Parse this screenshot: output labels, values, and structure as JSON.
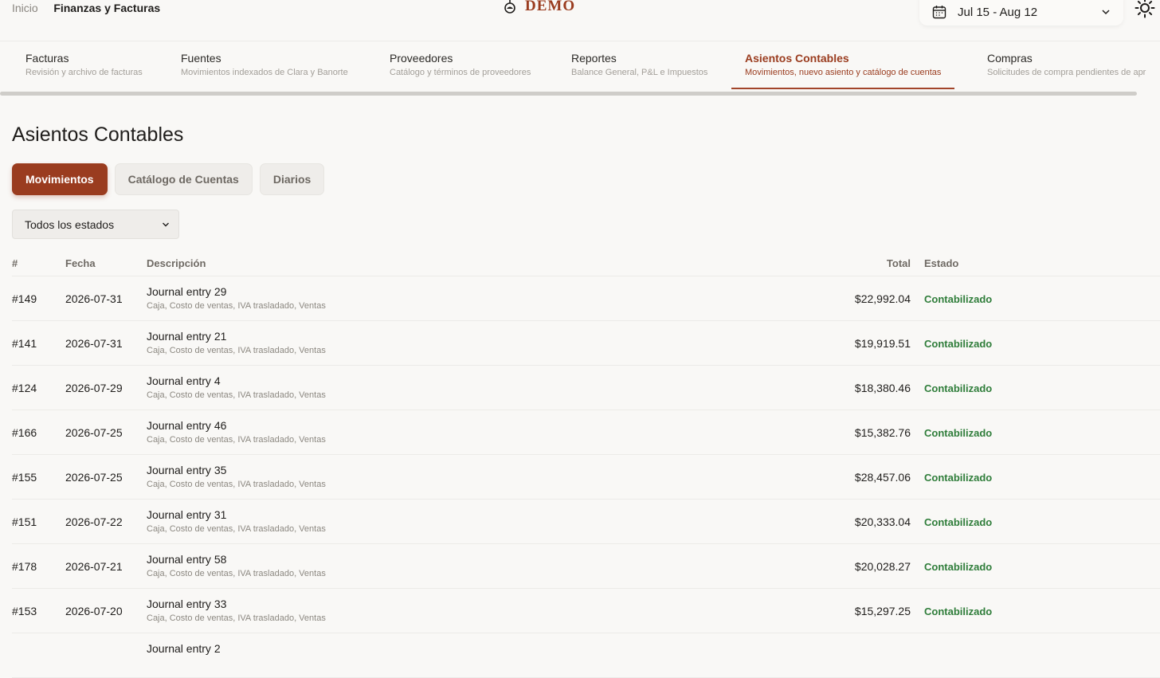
{
  "header": {
    "breadcrumb_home": "Inicio",
    "breadcrumb_separator": "/",
    "breadcrumb_current": "Finanzas y Facturas",
    "logo_text": "DEMO",
    "date_range": "Jul 15 - Aug 12"
  },
  "tabs": [
    {
      "title": "Facturas",
      "subtitle": "Revisión y archivo de facturas"
    },
    {
      "title": "Fuentes",
      "subtitle": "Movimientos indexados de Clara y Banorte"
    },
    {
      "title": "Proveedores",
      "subtitle": "Catálogo y términos de proveedores"
    },
    {
      "title": "Reportes",
      "subtitle": "Balance General, P&L e Impuestos"
    },
    {
      "title": "Asientos Contables",
      "subtitle": "Movimientos, nuevo asiento y catálogo de cuentas"
    },
    {
      "title": "Compras",
      "subtitle": "Solicitudes de compra pendientes de apr"
    }
  ],
  "page": {
    "title": "Asientos Contables",
    "segments": [
      "Movimientos",
      "Catálogo de Cuentas",
      "Diarios"
    ],
    "filter_value": "Todos los estados"
  },
  "table": {
    "headers": {
      "num": "#",
      "date": "Fecha",
      "desc": "Descripción",
      "total": "Total",
      "status": "Estado"
    },
    "rows": [
      {
        "num": "#149",
        "date": "2026-07-31",
        "title": "Journal entry 29",
        "accounts": "Caja, Costo de ventas, IVA trasladado, Ventas",
        "total": "$22,992.04",
        "status": "Contabilizado"
      },
      {
        "num": "#141",
        "date": "2026-07-31",
        "title": "Journal entry 21",
        "accounts": "Caja, Costo de ventas, IVA trasladado, Ventas",
        "total": "$19,919.51",
        "status": "Contabilizado"
      },
      {
        "num": "#124",
        "date": "2026-07-29",
        "title": "Journal entry 4",
        "accounts": "Caja, Costo de ventas, IVA trasladado, Ventas",
        "total": "$18,380.46",
        "status": "Contabilizado"
      },
      {
        "num": "#166",
        "date": "2026-07-25",
        "title": "Journal entry 46",
        "accounts": "Caja, Costo de ventas, IVA trasladado, Ventas",
        "total": "$15,382.76",
        "status": "Contabilizado"
      },
      {
        "num": "#155",
        "date": "2026-07-25",
        "title": "Journal entry 35",
        "accounts": "Caja, Costo de ventas, IVA trasladado, Ventas",
        "total": "$28,457.06",
        "status": "Contabilizado"
      },
      {
        "num": "#151",
        "date": "2026-07-22",
        "title": "Journal entry 31",
        "accounts": "Caja, Costo de ventas, IVA trasladado, Ventas",
        "total": "$20,333.04",
        "status": "Contabilizado"
      },
      {
        "num": "#178",
        "date": "2026-07-21",
        "title": "Journal entry 58",
        "accounts": "Caja, Costo de ventas, IVA trasladado, Ventas",
        "total": "$20,028.27",
        "status": "Contabilizado"
      },
      {
        "num": "#153",
        "date": "2026-07-20",
        "title": "Journal entry 33",
        "accounts": "Caja, Costo de ventas, IVA trasladado, Ventas",
        "total": "$15,297.25",
        "status": "Contabilizado"
      },
      {
        "num": "",
        "date": "",
        "title": "Journal entry 2",
        "accounts": "",
        "total": "",
        "status": ""
      }
    ]
  },
  "colors": {
    "accent": "#9a3c1f",
    "status_green": "#2f7d3a"
  }
}
